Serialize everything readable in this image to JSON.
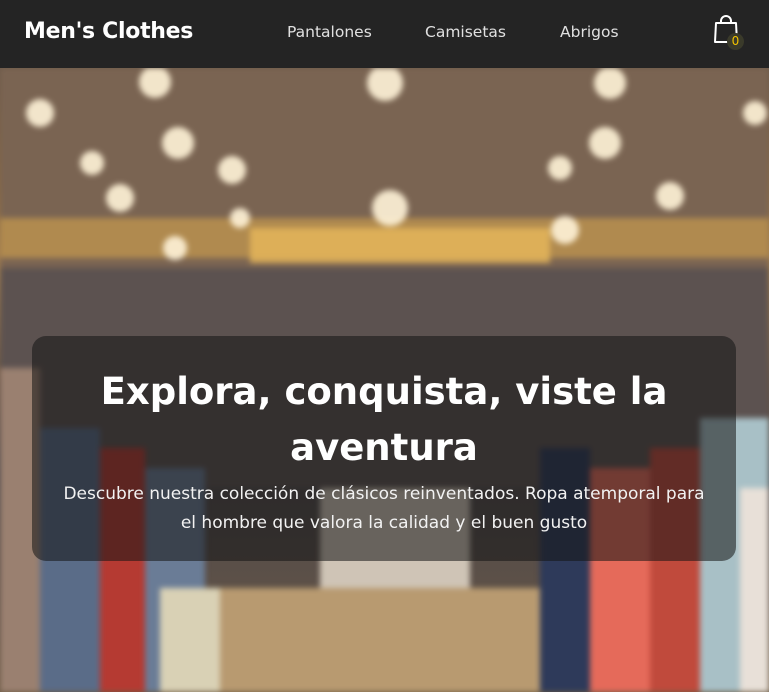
{
  "navbar": {
    "brand": "Men's Clothes",
    "links": [
      {
        "label": "Pantalones"
      },
      {
        "label": "Camisetas"
      },
      {
        "label": "Abrigos"
      }
    ],
    "cart": {
      "icon": "shopping-bag-icon",
      "count": "0"
    }
  },
  "hero": {
    "title": "Explora, conquista, viste la aventura",
    "subtitle": "Descubre nuestra colección de clásicos reinventados. Ropa atemporal para el hombre que valora la calidad y el buen gusto",
    "background": "blurred-clothing-store-image"
  },
  "colors": {
    "navbar_bg": "#242424",
    "cart_badge": "#f2c200",
    "overlay": "rgba(20,20,20,0.55)"
  }
}
